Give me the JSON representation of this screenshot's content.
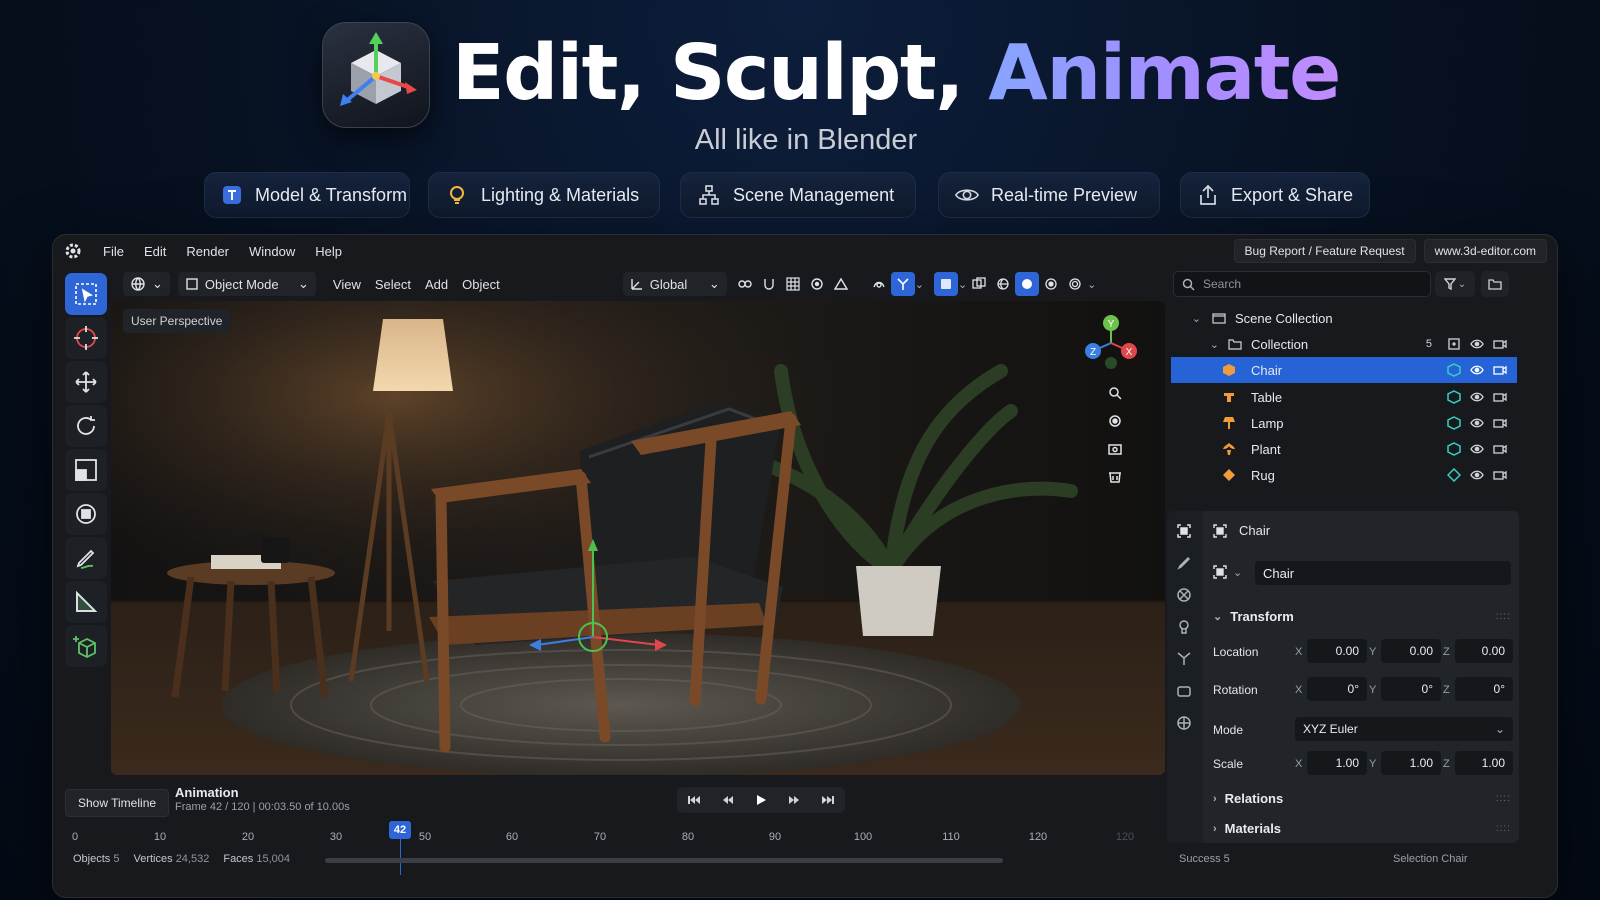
{
  "hero": {
    "headline_white": "Edit, Sculpt, ",
    "headline_accent": "Animate",
    "subtitle": "All like in Blender"
  },
  "features": [
    {
      "label": "Model & Transform",
      "icon": "model-transform-icon"
    },
    {
      "label": "Lighting & Materials",
      "icon": "lightbulb-icon"
    },
    {
      "label": "Scene Management",
      "icon": "hierarchy-icon"
    },
    {
      "label": "Real-time Preview",
      "icon": "eye-icon"
    },
    {
      "label": "Export & Share",
      "icon": "share-icon"
    }
  ],
  "menu": {
    "items": [
      "File",
      "Edit",
      "Render",
      "Window",
      "Help"
    ],
    "bug_report": "Bug Report / Feature Request",
    "website": "www.3d-editor.com"
  },
  "toolbar": {
    "mode": "Object Mode",
    "items": [
      "View",
      "Select",
      "Add",
      "Object"
    ],
    "orientation": "Global"
  },
  "viewport": {
    "label": "User Perspective",
    "axes": {
      "x": "X",
      "y": "Y",
      "z": "Z"
    }
  },
  "outliner": {
    "search_placeholder": "Search",
    "scene_collection": "Scene Collection",
    "collection": "Collection",
    "collection_count": "5",
    "objects": [
      {
        "name": "Chair",
        "selected": true
      },
      {
        "name": "Table",
        "selected": false
      },
      {
        "name": "Lamp",
        "selected": false
      },
      {
        "name": "Plant",
        "selected": false
      },
      {
        "name": "Rug",
        "selected": false
      }
    ]
  },
  "properties": {
    "object_title": "Chair",
    "object_name": "Chair",
    "transform_label": "Transform",
    "location_label": "Location",
    "rotation_label": "Rotation",
    "mode_label": "Mode",
    "scale_label": "Scale",
    "location": {
      "x": "0.00",
      "y": "0.00",
      "z": "0.00"
    },
    "rotation": {
      "x": "0°",
      "y": "0°",
      "z": "0°"
    },
    "mode_value": "XYZ Euler",
    "scale": {
      "x": "1.00",
      "y": "1.00",
      "z": "1.00"
    },
    "relations_label": "Relations",
    "materials_label": "Materials"
  },
  "timeline": {
    "show_button": "Show Timeline",
    "title": "Animation",
    "frame_info": "Frame 42 / 120 | 00:03.50 of 10.00s",
    "current_frame": "42",
    "ticks": [
      "0",
      "10",
      "20",
      "30",
      "50",
      "60",
      "70",
      "80",
      "90",
      "100",
      "110",
      "120",
      "120"
    ]
  },
  "status": {
    "objects_label": "Objects",
    "objects_value": "5",
    "vertices_label": "Vertices",
    "vertices_value": "24,532",
    "faces_label": "Faces",
    "faces_value": "15,004",
    "success": "Success 5",
    "selection": "Selection Chair"
  },
  "colors": {
    "accent": "#2563d6",
    "axis_x": "#e0474c",
    "axis_y": "#6cc24a",
    "axis_z": "#3b7fe0"
  }
}
